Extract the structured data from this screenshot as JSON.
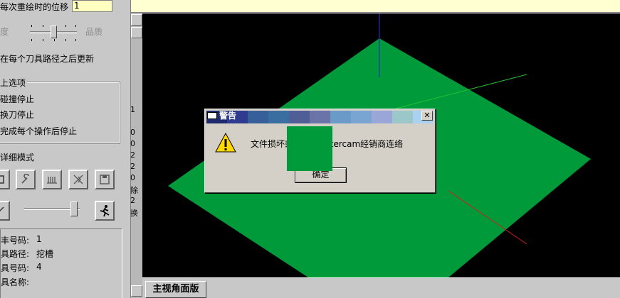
{
  "left_panel": {
    "offset_label": "每次重绘时的位移",
    "offset_value": "1",
    "speed_label_clipped": "度",
    "quality_label": "品质",
    "update_after_each_path": "在每个刀具路径之后更新",
    "stop_options_title": "上选项",
    "stop_on_collision": "碰撞停止",
    "stop_on_tool_change": "换刀停止",
    "stop_after_each_op": "完成每个操作后停止",
    "detail_mode_title": "详细模式",
    "info": {
      "program_no_label": "丰号码:",
      "program_no_value": "1",
      "toolpath_label": "具路径:",
      "toolpath_value": "挖槽",
      "tool_no_label": "具号码:",
      "tool_no_value": "4",
      "tool_name_label": "具名称:"
    }
  },
  "clipped_column": [
    "1",
    "0",
    "0",
    "2",
    "2",
    "0",
    "2",
    "除",
    "2",
    "换"
  ],
  "dialog": {
    "title": "警告",
    "close_glyph": "✕",
    "message": "文件损坏或                    您的Mastercam经销商连络",
    "ok_label": "确定",
    "title_colors": [
      "#1f2a6e",
      "#2f3b8e",
      "#375f9a",
      "#3a6da2",
      "#4f5e96",
      "#6a74a8",
      "#6a9ac8",
      "#7aa4d2",
      "#9aa6d8",
      "#9bc7c8",
      "#a9d2f0"
    ]
  },
  "viewport": {
    "tab_label": "主视角面版",
    "part_color": "#009a3a"
  }
}
